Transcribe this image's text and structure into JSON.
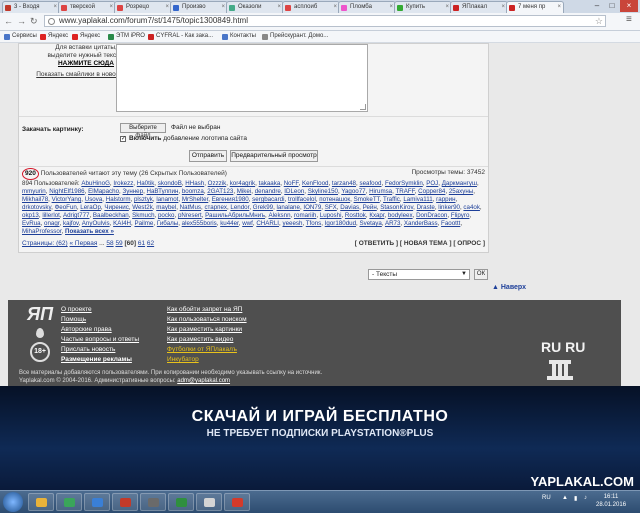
{
  "browser": {
    "tabs": [
      {
        "label": "3 - Входя",
        "color": "#c0392b"
      },
      {
        "label": "тверской",
        "color": "#d44"
      },
      {
        "label": "Розрецо",
        "color": "#d44"
      },
      {
        "label": "Произво",
        "color": "#3366cc"
      },
      {
        "label": "Оказоли",
        "color": "#4a8"
      },
      {
        "label": "асплоиб",
        "color": "#d44"
      },
      {
        "label": "Пломба",
        "color": "#e5c"
      },
      {
        "label": "Купить",
        "color": "#3a3"
      },
      {
        "label": "ЯПлакал",
        "color": "#c22"
      },
      {
        "label": "7 меня пр",
        "color": "#c22"
      }
    ],
    "url": "www.yaplakal.com/forum7/st/1475/topic1300849.html",
    "bookmarks": [
      {
        "label": "Сервисы",
        "color": "#4a76c8"
      },
      {
        "label": "Яндекс",
        "color": "#d22"
      },
      {
        "label": "Яндекс",
        "color": "#d22"
      },
      {
        "label": "ЭТМ iPRO",
        "color": "#2a8a4a"
      },
      {
        "label": "CYFRAL - Как зака...",
        "color": "#c22"
      },
      {
        "label": "Контакты",
        "color": "#4a76c8"
      },
      {
        "label": "Прейскурант. Домо...",
        "color": "#888"
      }
    ]
  },
  "form": {
    "help_lines": [
      "Для вставки цитаты,",
      "выделите нужный текст и"
    ],
    "help_bold": "НАЖМИТЕ СЮДА",
    "help_link": "Показать смайлики в новом окне",
    "attach_label": "Закачать картинку:",
    "file_button": "Выберите файл",
    "file_status": "Файл не выбран",
    "checkbox_bold": "Включить",
    "checkbox_rest": "добавление логотипа сайта",
    "send_button": "Отправить",
    "preview_button": "Предварительный просмотр"
  },
  "readers": {
    "count": "920",
    "text": "Пользователей читают эту тему (26 Скрытых Пользователей)",
    "views": "Просмотры темы: 37452"
  },
  "users": {
    "prefix": "894 Пользователей:",
    "names": [
      "AbuHinoG",
      "Irokezz",
      "Ha0tik",
      "skondoB",
      "HHash",
      "Ozzzik",
      "kor4agrik",
      "takaaka",
      "NoFF",
      "KenFlood",
      "tarzan48",
      "seafood",
      "FedorSymklin",
      "POJ",
      "Даркмангуш",
      "mmyurin",
      "NightElf1986",
      "ElMapacho",
      "Зуннер",
      "НаВТулпин",
      "boomza",
      "2GAT123",
      "Mikei",
      "denandre",
      "IDLeon",
      "Skyline150",
      "Yagoo77",
      "Hirumsa",
      "TRAFF",
      "Copper84",
      "25ахуны",
      "Mikhail78",
      "VictorYang",
      "Usova",
      "Halstorm",
      "plsztyk",
      "lanamot",
      "MrShelter",
      "Евгения1980",
      "sergbacardi",
      "trollfacelol",
      "потенашок",
      "SmokeTT",
      "Traffic",
      "Lamiva111",
      "гаррин",
      "drkotovsky",
      "ФеоFun",
      "LeraOp",
      "Чиренис",
      "West2k",
      "maybel",
      "NatMus",
      "старпех",
      "Lendor",
      "Grek99",
      "lanalane",
      "ION79",
      "SFX",
      "Davias",
      "Рейн",
      "StasonKirov",
      "Draste",
      "linker90",
      "са4ok",
      "okp13",
      "lillerlot",
      "Adrigt777",
      "Baalbeckhan",
      "Skmuch",
      "pocko",
      "pNresert",
      "РашильАбрильМниъ",
      "Aleksnn",
      "romariih",
      "Luposhi",
      "Rosttok",
      "Кхарг",
      "bodyleex",
      "DonDracon",
      "Flipyro",
      "EvRua",
      "onagr",
      "kajfov",
      "AnyOulvis",
      "KAI4H",
      "Pailme",
      "Гибалы",
      "alex555boris",
      "ku44er",
      "wwf",
      "CHARLI",
      "yeeesh",
      "Tfons",
      "Igor180dud",
      "Svetaya",
      "AR73",
      "XanderBass",
      "Faoottt",
      "MihaProfessor"
    ],
    "more": "Показать всех »"
  },
  "pager": {
    "label": "Страницы: (62)",
    "first": "« Первая",
    "dots": "...",
    "pages": [
      "58",
      "59"
    ],
    "current": "[60]",
    "next_pages": [
      "61",
      "62"
    ],
    "actions": "[ ОТВЕТИТЬ ] [ НОВАЯ ТЕМА ] [ ОПРОС ]"
  },
  "jump": {
    "selected": "- Тексты",
    "ok": "ОК",
    "up": "▲ Наверх"
  },
  "footer": {
    "logo": "ЯП",
    "age": "18+",
    "col1": [
      "О проекте",
      "Помощь",
      "Авторские права",
      "Частые вопросы и ответы",
      "Прислать новость",
      "Размещение рекламы"
    ],
    "col2": [
      "Как обойти запрет на ЯП",
      "Как пользоваться поиском",
      "Как разместить картинки",
      "Как разместить видео",
      "Футболки от ЯПлакалъ",
      "Инкубатор"
    ],
    "copy1": "Все материалы добавляются пользователями. При копировании необходимо указывать ссылку на источник.",
    "copy2": "Yaplakal.com © 2004-2016. Административные вопросы:",
    "mail": "adm@yaplakal.com",
    "ru_logo": "RU RU"
  },
  "desktop": {
    "line1": "СКАЧАЙ И ИГРАЙ БЕСПЛАТНО",
    "line2": "НЕ ТРЕБУЕТ ПОДПИСКИ PLAYSTATION®PLUS",
    "watermark": "YAPLAKAL.COM"
  },
  "taskbar": {
    "lang": "RU",
    "time": "16:11",
    "date": "28.01.2016",
    "apps": [
      {
        "color": "#e8b23a"
      },
      {
        "color": "#3aa55a"
      },
      {
        "color": "#3a7fd6"
      },
      {
        "color": "#c23a2a"
      },
      {
        "color": "#6a6a6a"
      },
      {
        "color": "#2f8f3f"
      },
      {
        "color": "#d4d4d4"
      },
      {
        "color": "#d43a2a"
      }
    ]
  },
  "colors": {
    "link": "#1d3f99",
    "highlight_circle": "#d3182b",
    "footer_bg": "#4f4f4f"
  }
}
